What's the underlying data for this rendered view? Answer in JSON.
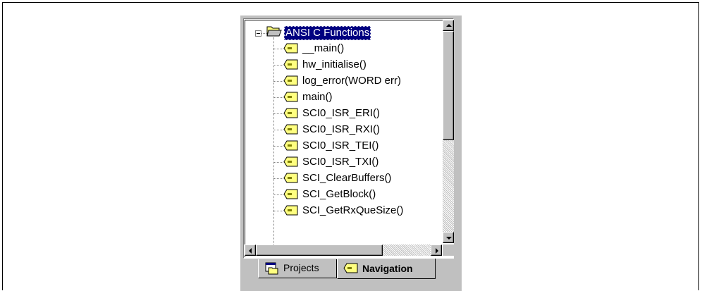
{
  "tree": {
    "root": {
      "label": "ANSI C Functions",
      "icon": "folder-icon"
    },
    "items": [
      "__main()",
      "hw_initialise()",
      "log_error(WORD err)",
      "main()",
      "SCI0_ISR_ERI()",
      "SCI0_ISR_RXI()",
      "SCI0_ISR_TEI()",
      "SCI0_ISR_TXI()",
      "SCI_ClearBuffers()",
      "SCI_GetBlock()",
      "SCI_GetRxQueSize()"
    ],
    "item_icon": "function-tag-icon"
  },
  "tabs": [
    {
      "label": "Projects",
      "icon": "projects-icon",
      "active": false
    },
    {
      "label": "Navigation",
      "icon": "function-tag-icon",
      "active": true
    }
  ],
  "colors": {
    "selection": "#000080",
    "panel": "#c0c0c0",
    "tag": "#ffff80"
  }
}
